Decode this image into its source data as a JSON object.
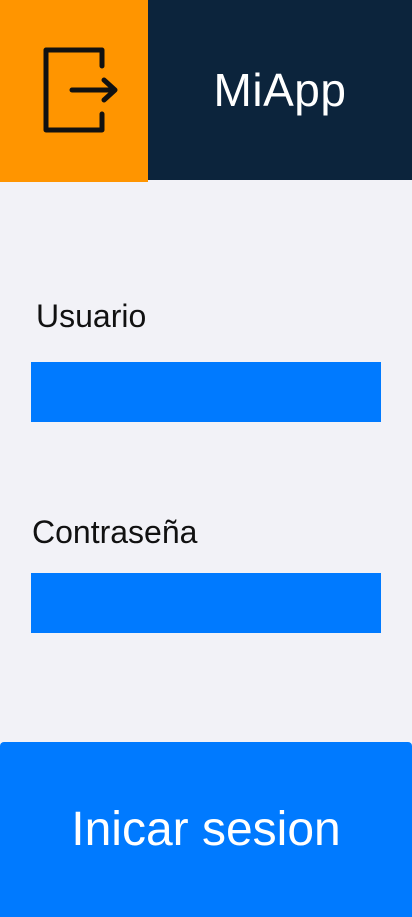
{
  "header": {
    "icon": "logout-icon",
    "title": "MiApp",
    "colors": {
      "icon_bg": "#ff9500",
      "title_bg": "#0c243c"
    }
  },
  "form": {
    "username_label": "Usuario",
    "username_value": "",
    "password_label": "Contraseña",
    "password_value": "",
    "field_color": "#007aff"
  },
  "login_button": {
    "label": "Inicar sesion",
    "color": "#007aff"
  }
}
